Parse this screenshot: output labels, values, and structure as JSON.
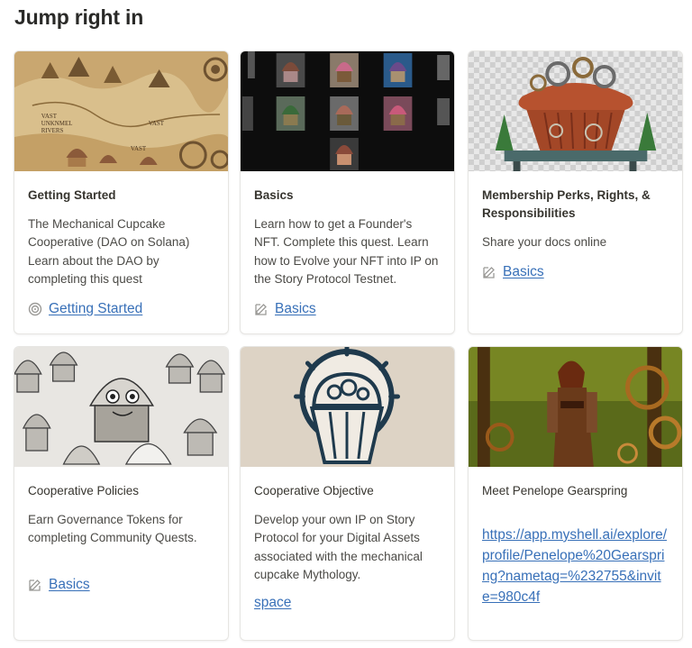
{
  "section": {
    "title": "Jump right in"
  },
  "cards": [
    {
      "image": "steampunk-cupcake-map",
      "title": "Getting Started",
      "description": "The Mechanical Cupcake Cooperative (DAO on Solana) Learn about the DAO by completing this quest",
      "link_icon": "target-icon",
      "link_label": "Getting Started"
    },
    {
      "image": "cupcake-nft-gallery",
      "title": "Basics",
      "description": "Learn how to get a Founder's NFT. Complete this quest. Learn how to Evolve your NFT into IP on the Story Protocol Testnet.",
      "link_icon": "edit-icon",
      "link_label": "Basics"
    },
    {
      "image": "gear-cupcake-transparent",
      "title": "Membership Perks, Rights, & Responsibilities",
      "description": "Share your docs online",
      "link_icon": "edit-icon",
      "link_label": "Basics"
    },
    {
      "image": "robot-cupcakes-sketch",
      "title": "Cooperative Policies",
      "description": "Earn Governance Tokens for completing Community Quests.",
      "link_icon": "edit-icon",
      "link_label": "Basics"
    },
    {
      "image": "gear-cupcake-logo",
      "title": "Cooperative Objective",
      "description": "Develop your own IP on Story Protocol for your Digital Assets associated with the mechanical cupcake Mythology.",
      "link_label": "space"
    },
    {
      "image": "penelope-gearspring-portrait",
      "title": "Meet Penelope Gearspring",
      "url": "https://app.myshell.ai/explore/profile/Penelope%20Gearspring?nametag=%232755&invite=980c4f"
    }
  ],
  "colors": {
    "link": "#3870b8",
    "border": "#e6e5e2",
    "text": "#37352f"
  }
}
